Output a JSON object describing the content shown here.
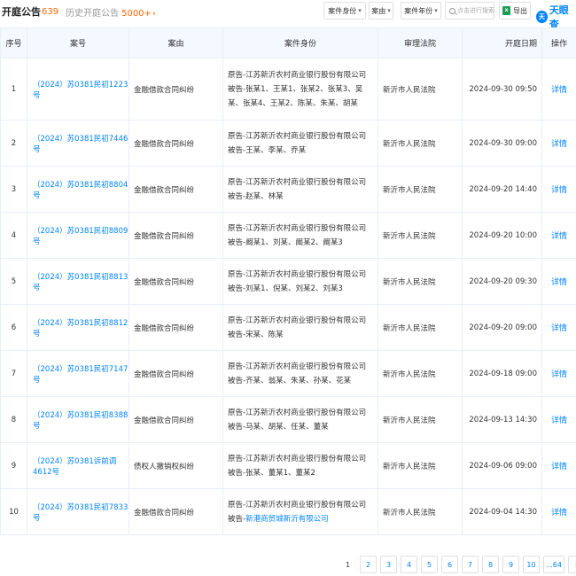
{
  "header": {
    "title": "开庭公告",
    "count": "639",
    "history_label": "历史开庭公告",
    "history_count": "5000+",
    "history_arrow": "›"
  },
  "toolbar": {
    "filter_identity": "案件身份",
    "filter_cause": "案由",
    "filter_year": "案件年份",
    "caret": "▾",
    "search_placeholder": "点击进行搜索",
    "export_icon": "x",
    "export_label": "导出",
    "brand_icon": "天",
    "brand_name": "天眼查"
  },
  "table": {
    "columns": [
      "序号",
      "案号",
      "案由",
      "案件身份",
      "审理法院",
      "开庭日期",
      "操作"
    ],
    "rows": [
      {
        "idx": "1",
        "case_no": "（2024）苏0381民初1223号",
        "cause": "金融借款合同纠纷",
        "plaintiff": "原告-江苏新沂农村商业银行股份有限公司",
        "defendant": "被告-张某1、王某1、张某2、张某3、吴某、张某4、王某2、陈某、朱某、胡某",
        "court": "新沂市人民法院",
        "date": "2024-09-30 09:50",
        "op": "详情"
      },
      {
        "idx": "2",
        "case_no": "（2024）苏0381民初7446号",
        "cause": "金融借款合同纠纷",
        "plaintiff": "原告-江苏新沂农村商业银行股份有限公司",
        "defendant": "被告-王某、李某、乔某",
        "court": "新沂市人民法院",
        "date": "2024-09-30 09:00",
        "op": "详情"
      },
      {
        "idx": "3",
        "case_no": "（2024）苏0381民初8804号",
        "cause": "金融借款合同纠纷",
        "plaintiff": "原告-江苏新沂农村商业银行股份有限公司",
        "defendant": "被告-赵某、林某",
        "court": "新沂市人民法院",
        "date": "2024-09-20 14:40",
        "op": "详情"
      },
      {
        "idx": "4",
        "case_no": "（2024）苏0381民初8809号",
        "cause": "金融借款合同纠纷",
        "plaintiff": "原告-江苏新沂农村商业银行股份有限公司",
        "defendant": "被告-阚某1、刘某、阚某2、阚某3",
        "court": "新沂市人民法院",
        "date": "2024-09-20 10:00",
        "op": "详情"
      },
      {
        "idx": "5",
        "case_no": "（2024）苏0381民初8813号",
        "cause": "金融借款合同纠纷",
        "plaintiff": "原告-江苏新沂农村商业银行股份有限公司",
        "defendant": "被告-刘某1、倪某、刘某2、刘某3",
        "court": "新沂市人民法院",
        "date": "2024-09-20 09:30",
        "op": "详情"
      },
      {
        "idx": "6",
        "case_no": "（2024）苏0381民初8812号",
        "cause": "金融借款合同纠纷",
        "plaintiff": "原告-江苏新沂农村商业银行股份有限公司",
        "defendant": "被告-宋某、陈某",
        "court": "新沂市人民法院",
        "date": "2024-09-20 09:00",
        "op": "详情"
      },
      {
        "idx": "7",
        "case_no": "（2024）苏0381民初7147号",
        "cause": "金融借款合同纠纷",
        "plaintiff": "原告-江苏新沂农村商业银行股份有限公司",
        "defendant": "被告-齐某、翁某、朱某、孙某、花某",
        "court": "新沂市人民法院",
        "date": "2024-09-18 09:00",
        "op": "详情"
      },
      {
        "idx": "8",
        "case_no": "（2024）苏0381民初8388号",
        "cause": "金融借款合同纠纷",
        "plaintiff": "原告-江苏新沂农村商业银行股份有限公司",
        "defendant": "被告-马某、胡某、任某、董某",
        "court": "新沂市人民法院",
        "date": "2024-09-13 14:30",
        "op": "详情"
      },
      {
        "idx": "9",
        "case_no": "（2024）苏0381诉前调4612号",
        "cause": "债权人撤销权纠纷",
        "plaintiff": "原告-江苏新沂农村商业银行股份有限公司",
        "defendant": "被告-张某、董某1、董某2",
        "court": "新沂市人民法院",
        "date": "2024-09-06 09:00",
        "op": "详情"
      },
      {
        "idx": "10",
        "case_no": "（2024）苏0381民初7833号",
        "cause": "金融借款合同纠纷",
        "plaintiff": "原告-江苏新沂农村商业银行股份有限公司",
        "defendant_prefix": "被告-",
        "defendant_link": "新港商贸城新沂有限公司",
        "court": "新沂市人民法院",
        "date": "2024-09-04 14:30",
        "op": "详情"
      }
    ]
  },
  "pagination": {
    "pages": [
      "1",
      "2",
      "3",
      "4",
      "5",
      "6",
      "7",
      "8",
      "9",
      "10",
      "...64"
    ],
    "current": "1",
    "next": "›"
  }
}
